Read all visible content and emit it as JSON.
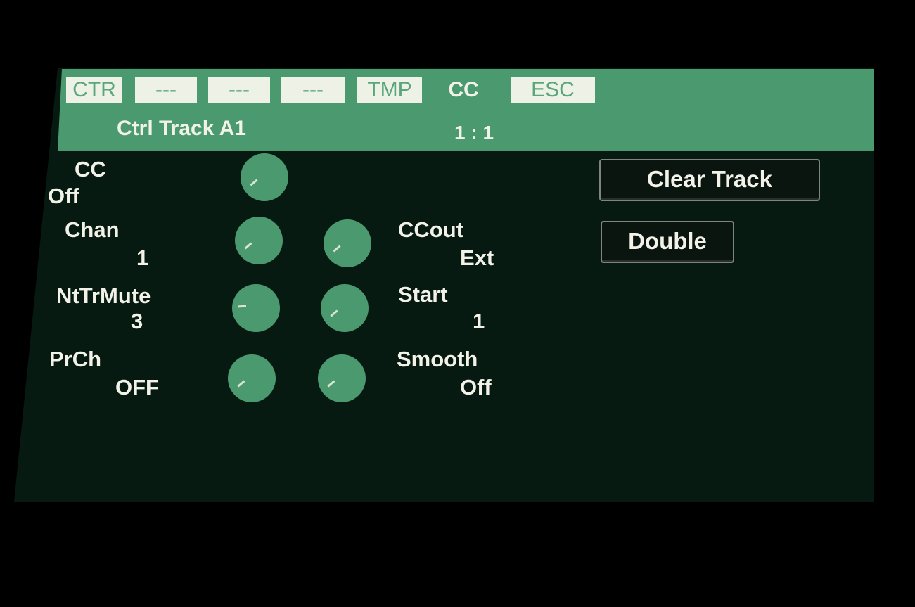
{
  "tabs": [
    {
      "label": "CTR",
      "style": "box"
    },
    {
      "label": "---",
      "style": "box"
    },
    {
      "label": "---",
      "style": "box"
    },
    {
      "label": "---",
      "style": "box"
    },
    {
      "label": "TMP",
      "style": "box"
    },
    {
      "label": "CC",
      "style": "plain"
    },
    {
      "label": "ESC",
      "style": "box"
    }
  ],
  "header": {
    "title": "Ctrl Track A1",
    "position": "1 : 1"
  },
  "params": {
    "cc": {
      "label": "CC",
      "value": "Off"
    },
    "chan": {
      "label": "Chan",
      "value": "1"
    },
    "ntrmute": {
      "label": "NtTrMute",
      "value": "3"
    },
    "prch": {
      "label": "PrCh",
      "value": "OFF"
    },
    "ccout": {
      "label": "CCout",
      "value": "Ext"
    },
    "start": {
      "label": "Start",
      "value": "1"
    },
    "smooth": {
      "label": "Smooth",
      "value": "Off"
    }
  },
  "buttons": {
    "clear_track": "Clear Track",
    "double": "Double"
  },
  "colors": {
    "accent": "#4b9a6f",
    "background": "#071a12",
    "text": "#f2f2e8"
  }
}
